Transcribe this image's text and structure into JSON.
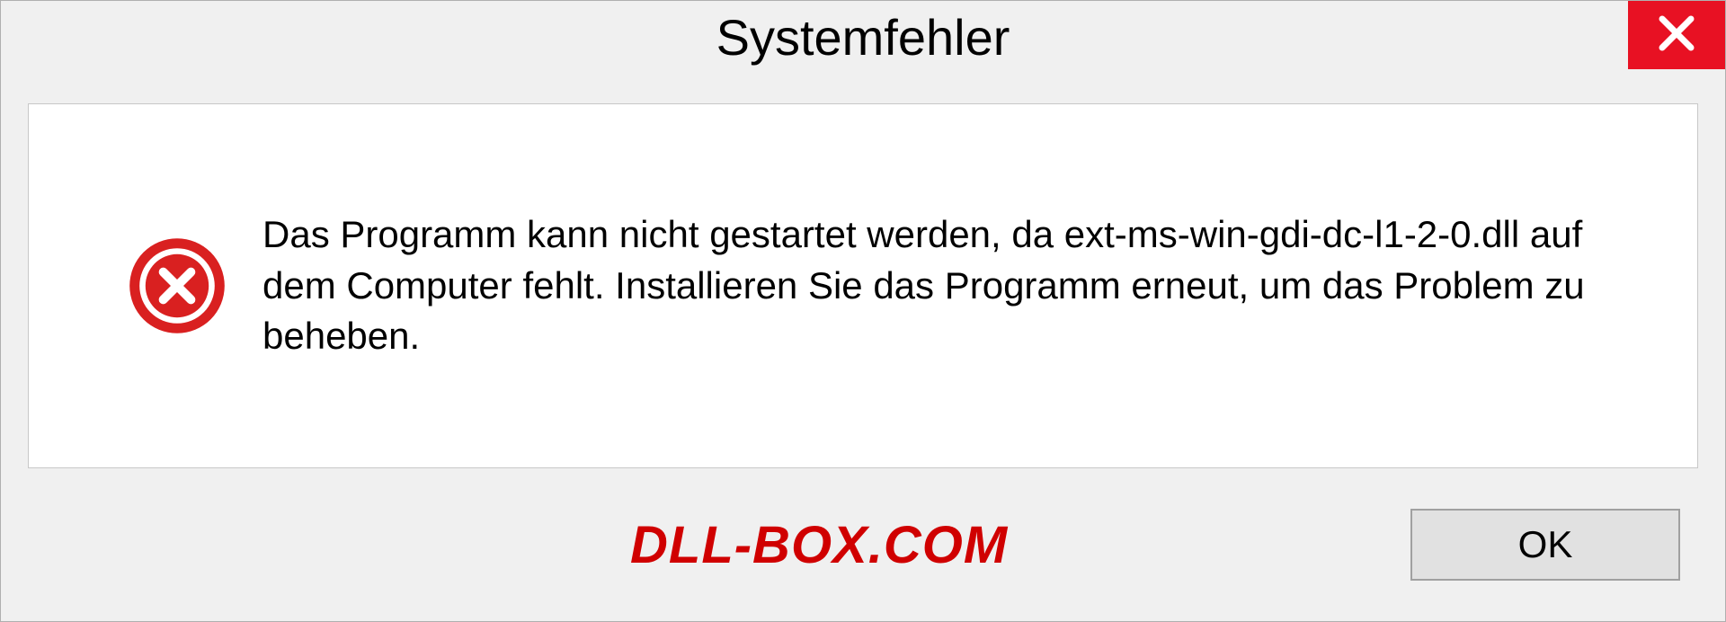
{
  "dialog": {
    "title": "Systemfehler",
    "message": "Das Programm kann nicht gestartet werden, da ext-ms-win-gdi-dc-l1-2-0.dll auf dem Computer fehlt. Installieren Sie das Programm erneut, um das Problem zu beheben.",
    "ok_label": "OK"
  },
  "watermark": "DLL-BOX.COM"
}
